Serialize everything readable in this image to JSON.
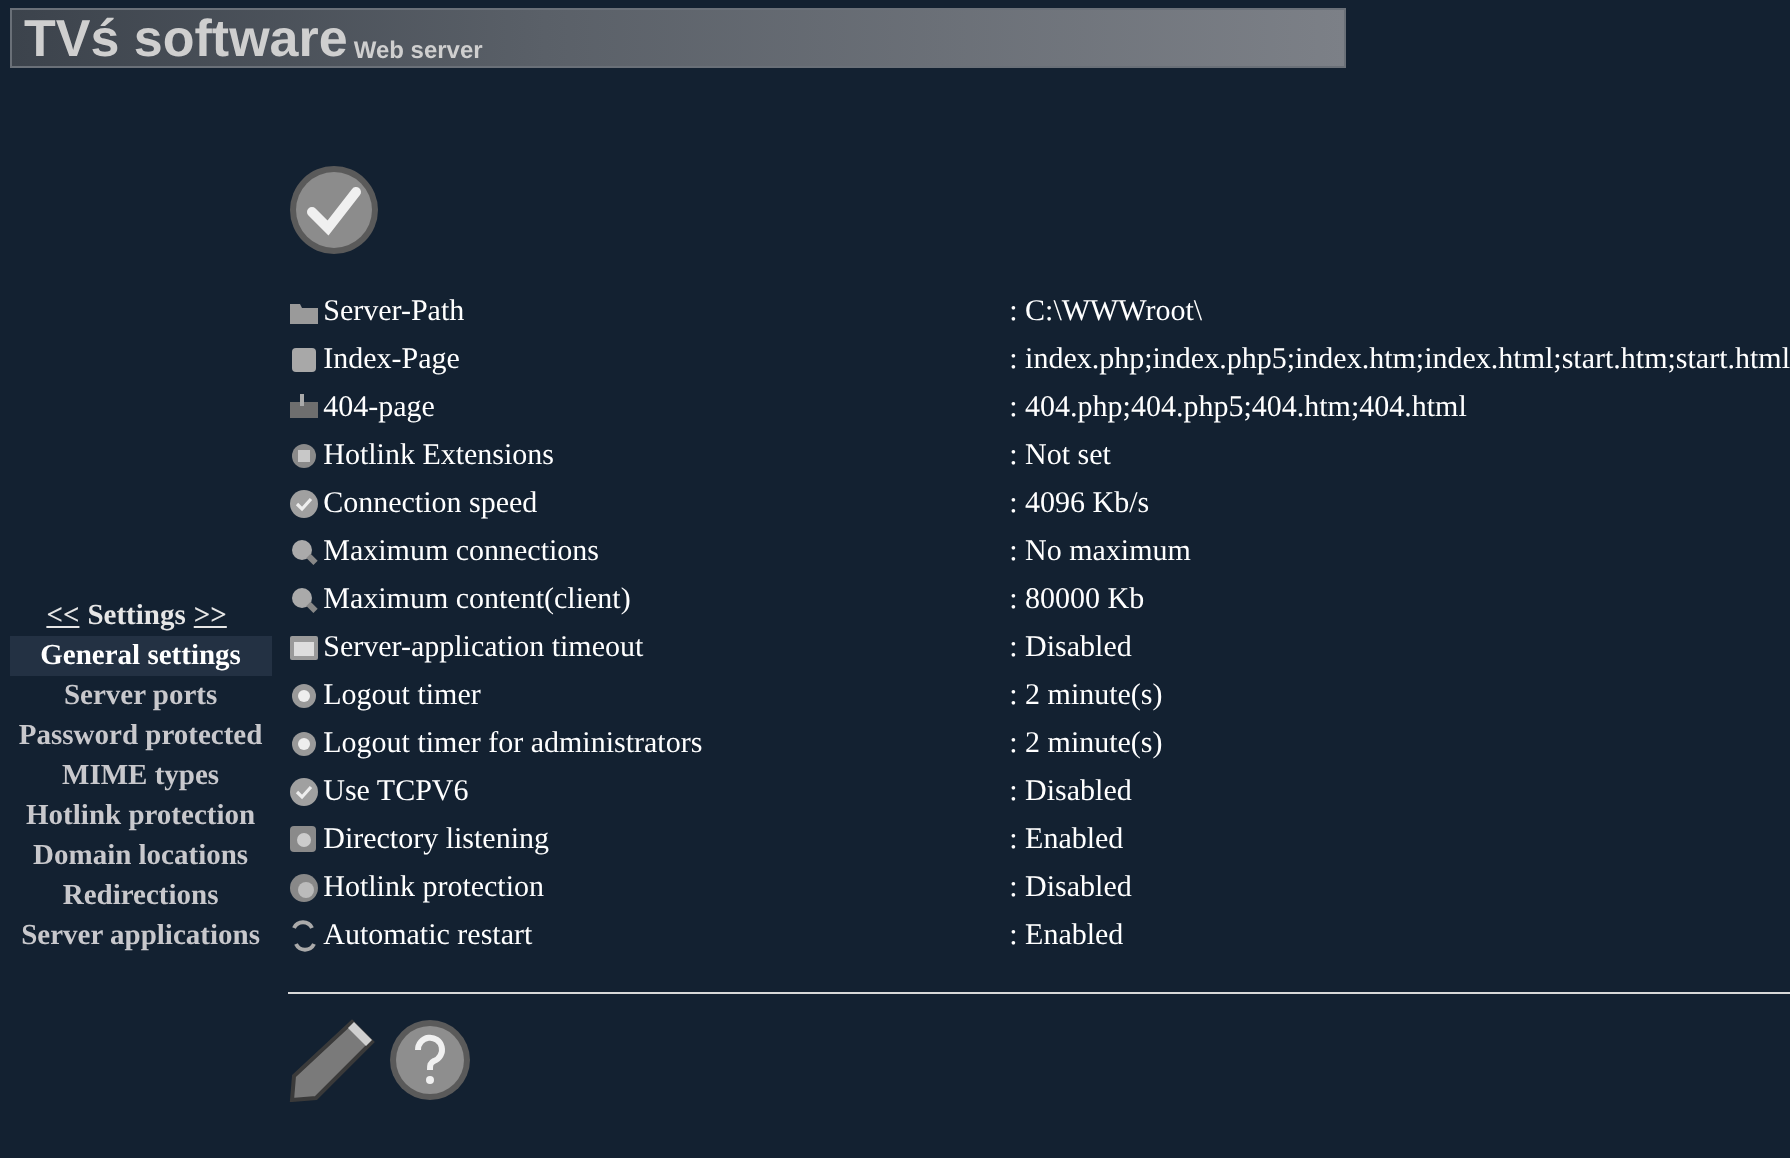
{
  "header": {
    "title": "TVś software",
    "subtitle": "Web server"
  },
  "sidebar": {
    "prev": "<<",
    "title": "Settings",
    "next": ">>",
    "items": [
      {
        "label": "General settings",
        "selected": true
      },
      {
        "label": "Server ports",
        "selected": false
      },
      {
        "label": "Password protected",
        "selected": false
      },
      {
        "label": "MIME types",
        "selected": false
      },
      {
        "label": "Hotlink protection",
        "selected": false
      },
      {
        "label": "Domain locations",
        "selected": false
      },
      {
        "label": "Redirections",
        "selected": false
      },
      {
        "label": "Server applications",
        "selected": false
      }
    ]
  },
  "settings": [
    {
      "label": "Server-Path",
      "value": ": C:\\WWWroot\\"
    },
    {
      "label": "Index-Page",
      "value": ": index.php;index.php5;index.htm;index.html;start.htm;start.html"
    },
    {
      "label": "404-page",
      "value": ": 404.php;404.php5;404.htm;404.html"
    },
    {
      "label": "Hotlink Extensions",
      "value": ": Not set"
    },
    {
      "label": "Connection speed",
      "value": ": 4096 Kb/s"
    },
    {
      "label": "Maximum connections",
      "value": ": No maximum"
    },
    {
      "label": "Maximum content(client)",
      "value": ": 80000 Kb"
    },
    {
      "label": "Server-application timeout",
      "value": ": Disabled"
    },
    {
      "label": "Logout timer",
      "value": ": 2 minute(s)"
    },
    {
      "label": "Logout timer for administrators",
      "value": ": 2 minute(s)"
    },
    {
      "label": "Use TCPV6",
      "value": ": Disabled"
    },
    {
      "label": "Directory listening",
      "value": ": Enabled"
    },
    {
      "label": "Hotlink protection",
      "value": ": Disabled"
    },
    {
      "label": "Automatic restart",
      "value": ": Enabled"
    }
  ]
}
